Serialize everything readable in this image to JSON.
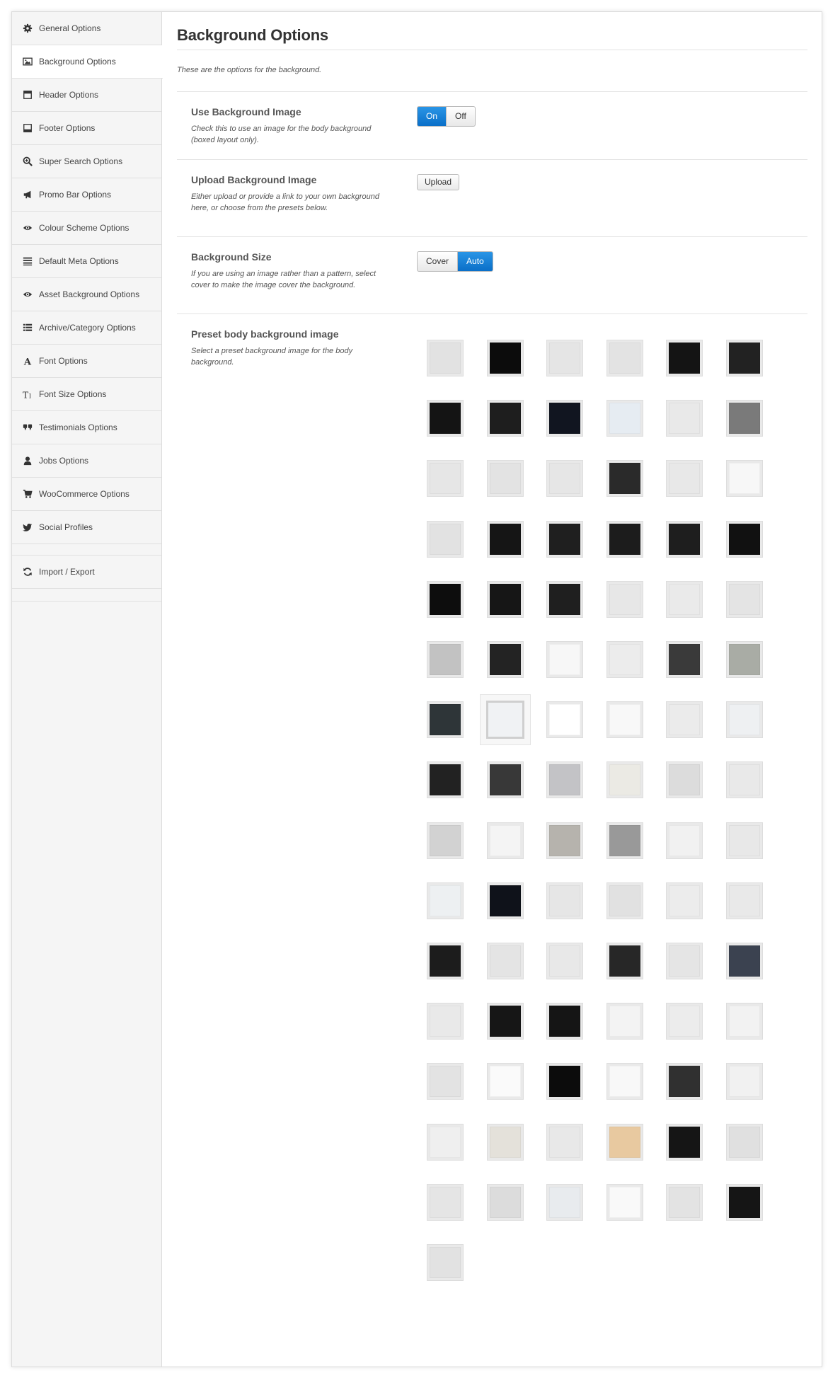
{
  "sidebar": {
    "items": [
      {
        "label": "General Options",
        "icon": "gear-icon",
        "name": "sidebar-item-general-options",
        "active": false
      },
      {
        "label": "Background Options",
        "icon": "image-icon",
        "name": "sidebar-item-background-options",
        "active": true
      },
      {
        "label": "Header Options",
        "icon": "header-icon",
        "name": "sidebar-item-header-options",
        "active": false
      },
      {
        "label": "Footer Options",
        "icon": "footer-icon",
        "name": "sidebar-item-footer-options",
        "active": false
      },
      {
        "label": "Super Search Options",
        "icon": "zoom-in-icon",
        "name": "sidebar-item-super-search-options",
        "active": false
      },
      {
        "label": "Promo Bar Options",
        "icon": "bullhorn-icon",
        "name": "sidebar-item-promo-bar-options",
        "active": false
      },
      {
        "label": "Colour Scheme Options",
        "icon": "eye-icon",
        "name": "sidebar-item-colour-scheme-options",
        "active": false
      },
      {
        "label": "Default Meta Options",
        "icon": "align-justify-icon",
        "name": "sidebar-item-default-meta-options",
        "active": false
      },
      {
        "label": "Asset Background Options",
        "icon": "eye-icon",
        "name": "sidebar-item-asset-background-options",
        "active": false
      },
      {
        "label": "Archive/Category Options",
        "icon": "list-icon",
        "name": "sidebar-item-archive-category-options",
        "active": false
      },
      {
        "label": "Font Options",
        "icon": "font-icon",
        "name": "sidebar-item-font-options",
        "active": false
      },
      {
        "label": "Font Size Options",
        "icon": "text-size-icon",
        "name": "sidebar-item-font-size-options",
        "active": false
      },
      {
        "label": "Testimonials Options",
        "icon": "quote-icon",
        "name": "sidebar-item-testimonials-options",
        "active": false
      },
      {
        "label": "Jobs Options",
        "icon": "user-icon",
        "name": "sidebar-item-jobs-options",
        "active": false
      },
      {
        "label": "WooCommerce Options",
        "icon": "cart-icon",
        "name": "sidebar-item-woocommerce-options",
        "active": false
      },
      {
        "label": "Social Profiles",
        "icon": "twitter-icon",
        "name": "sidebar-item-social-profiles",
        "active": false
      }
    ],
    "footer_items": [
      {
        "label": "Import / Export",
        "icon": "refresh-icon",
        "name": "sidebar-item-import-export"
      }
    ]
  },
  "main": {
    "title": "Background Options",
    "description": "These are the options for the background.",
    "sections": {
      "use_bg": {
        "title": "Use Background Image",
        "description": "Check this to use an image for the body background (boxed layout only).",
        "on_label": "On",
        "off_label": "Off",
        "value": "On"
      },
      "upload_bg": {
        "title": "Upload Background Image",
        "description": "Either upload or provide a link to your own background here, or choose from the presets below.",
        "button_label": "Upload"
      },
      "bg_size": {
        "title": "Background Size",
        "description": "If you are using an image rather than a pattern, select cover to make the image cover the background.",
        "cover_label": "Cover",
        "auto_label": "Auto",
        "value": "Auto"
      },
      "preset": {
        "title": "Preset body background image",
        "description": "Select a preset background image for the body background.",
        "selected_index": 37,
        "swatches": [
          "#e2e2e2",
          "#0c0c0c",
          "#e5e5e5",
          "#e3e3e3",
          "#141414",
          "#222222",
          "#141414",
          "#1e1e1e",
          "#111520",
          "#e6ecf2",
          "#e9e9e9",
          "#7a7a7a",
          "#e6e6e6",
          "#e3e3e3",
          "#e6e6e6",
          "#2a2a2a",
          "#e8e8e8",
          "#f7f7f7",
          "#e2e2e2",
          "#151515",
          "#1f1f1f",
          "#1c1c1c",
          "#1e1e1e",
          "#111111",
          "#0d0d0d",
          "#161616",
          "#1f1f1f",
          "#e7e7e7",
          "#eaeaea",
          "#e4e4e4",
          "#c2c2c2",
          "#232323",
          "#f7f7f7",
          "#ececec",
          "#3a3a3a",
          "#a9aca5",
          "#2e3538",
          "#f0f2f4",
          "#ffffff",
          "#f8f8f8",
          "#ebebeb",
          "#eef0f2",
          "#222222",
          "#383838",
          "#c3c3c6",
          "#ebeae4",
          "#dcdcdc",
          "#e9e9e9",
          "#d2d2d2",
          "#f4f4f4",
          "#b6b3ad",
          "#999999",
          "#f1f1f1",
          "#e8e8e8",
          "#edf0f2",
          "#0f121a",
          "#e6e6e6",
          "#e1e1e1",
          "#ececec",
          "#e9e9e9",
          "#1c1c1c",
          "#e4e4e4",
          "#e8e8e8",
          "#272727",
          "#e5e5e5",
          "#3b4250",
          "#e9e9e9",
          "#161616",
          "#151515",
          "#f3f3f3",
          "#ececec",
          "#f2f2f2",
          "#e3e3e3",
          "#fafafa",
          "#0c0c0c",
          "#f8f8f8",
          "#303030",
          "#f1f1f1",
          "#efefef",
          "#e4e1da",
          "#e8e8e8",
          "#e8c9a0",
          "#151515",
          "#e0e0e0",
          "#e5e5e5",
          "#dcdcdc",
          "#e8ebee",
          "#f9f9f9",
          "#e3e3e3",
          "#151515",
          "#e2e2e2"
        ]
      }
    }
  },
  "colors": {
    "accent_blue": "#0a6fc8",
    "sidebar_bg": "#f5f5f5",
    "divider": "#e3e3e3"
  }
}
